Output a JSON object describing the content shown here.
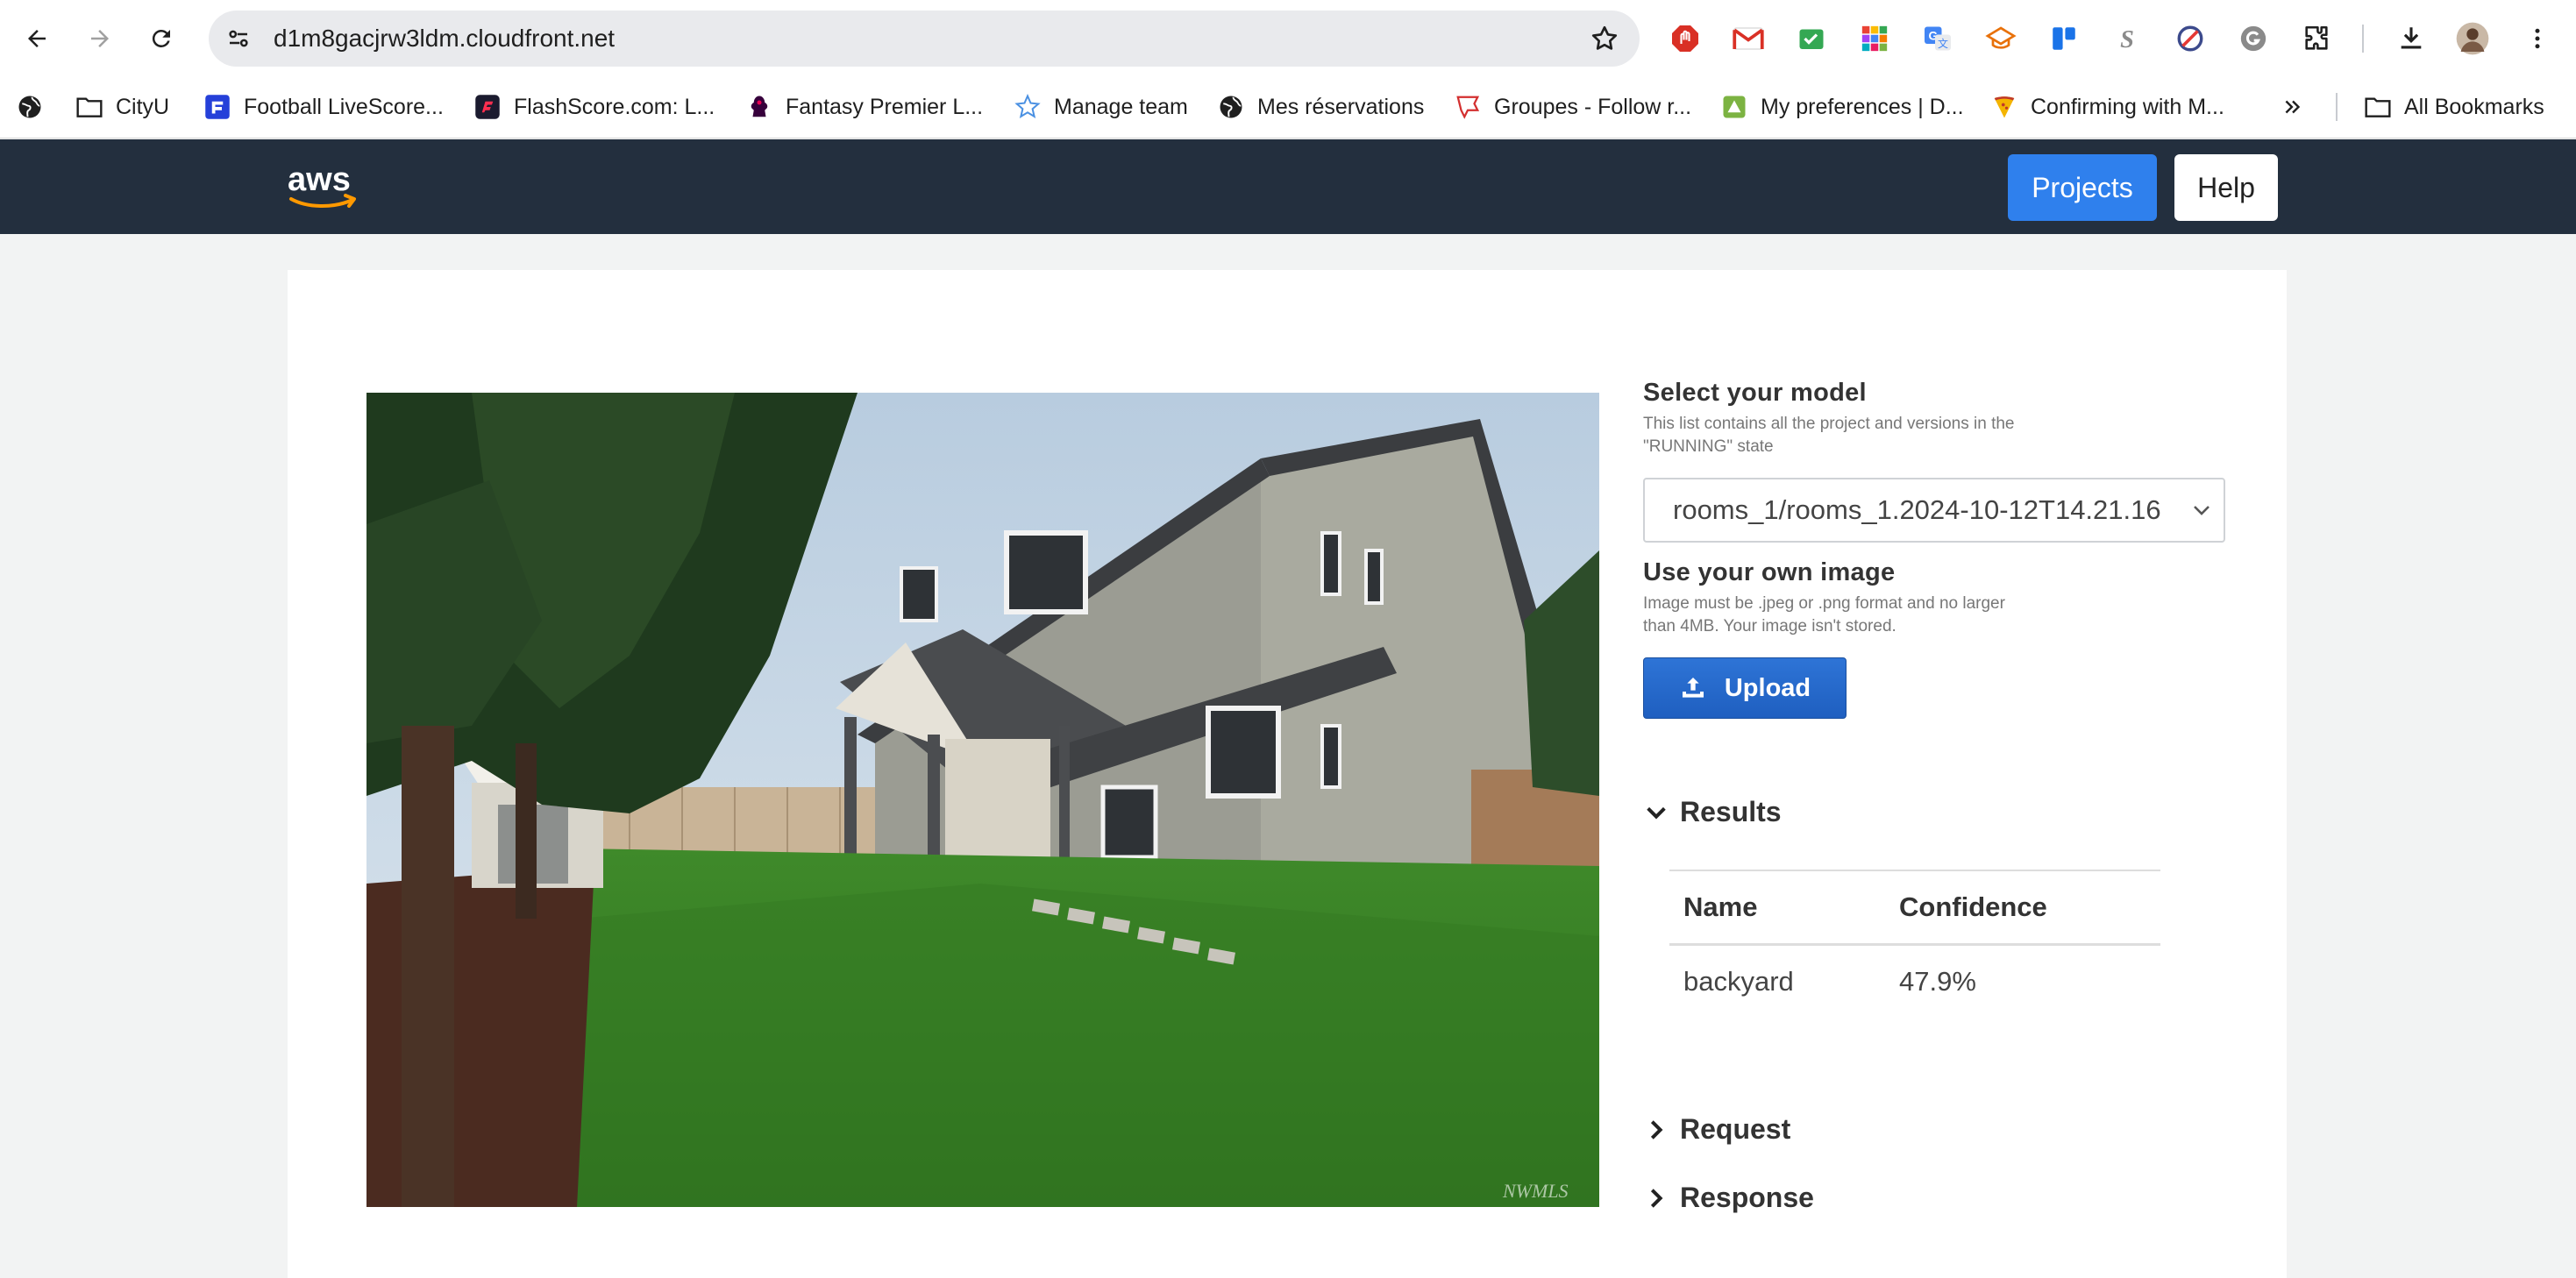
{
  "browser": {
    "url": "d1m8gacjrw3ldm.cloudfront.net",
    "bookmarks": [
      {
        "label": "CityU",
        "icon": "folder-icon"
      },
      {
        "label": "Football LiveScore...",
        "icon": "football-livescore-icon"
      },
      {
        "label": "FlashScore.com: L...",
        "icon": "flashscore-icon"
      },
      {
        "label": "Fantasy Premier L...",
        "icon": "premier-league-icon"
      },
      {
        "label": "Manage team",
        "icon": "manage-team-icon"
      },
      {
        "label": "Mes réservations",
        "icon": "globe-icon"
      },
      {
        "label": "Groupes - Follow r...",
        "icon": "groupes-icon"
      },
      {
        "label": "My preferences | D...",
        "icon": "preferences-icon"
      },
      {
        "label": "Confirming with M...",
        "icon": "pizza-icon"
      }
    ],
    "all_bookmarks": "All Bookmarks"
  },
  "header": {
    "projects_label": "Projects",
    "help_label": "Help"
  },
  "panel": {
    "select_model_title": "Select your model",
    "select_model_desc": "This list contains all the project and versions in the \"RUNNING\" state",
    "model_value": "rooms_1/rooms_1.2024-10-12T14.21.16",
    "own_image_title": "Use your own image",
    "own_image_desc": "Image must be .jpeg or .png format and no larger than 4MB. Your image isn't stored.",
    "upload_label": "Upload",
    "results_label": "Results",
    "request_label": "Request",
    "response_label": "Response"
  },
  "results": {
    "columns": [
      "Name",
      "Confidence"
    ],
    "rows": [
      {
        "name": "backyard",
        "confidence": "47.9%"
      }
    ]
  },
  "photo": {
    "watermark": "NWMLS"
  },
  "colors": {
    "header_bg": "#232f3e",
    "projects_button": "#2f80ed",
    "upload_button": "#2e74d6",
    "page_bg": "#f2f3f3"
  }
}
